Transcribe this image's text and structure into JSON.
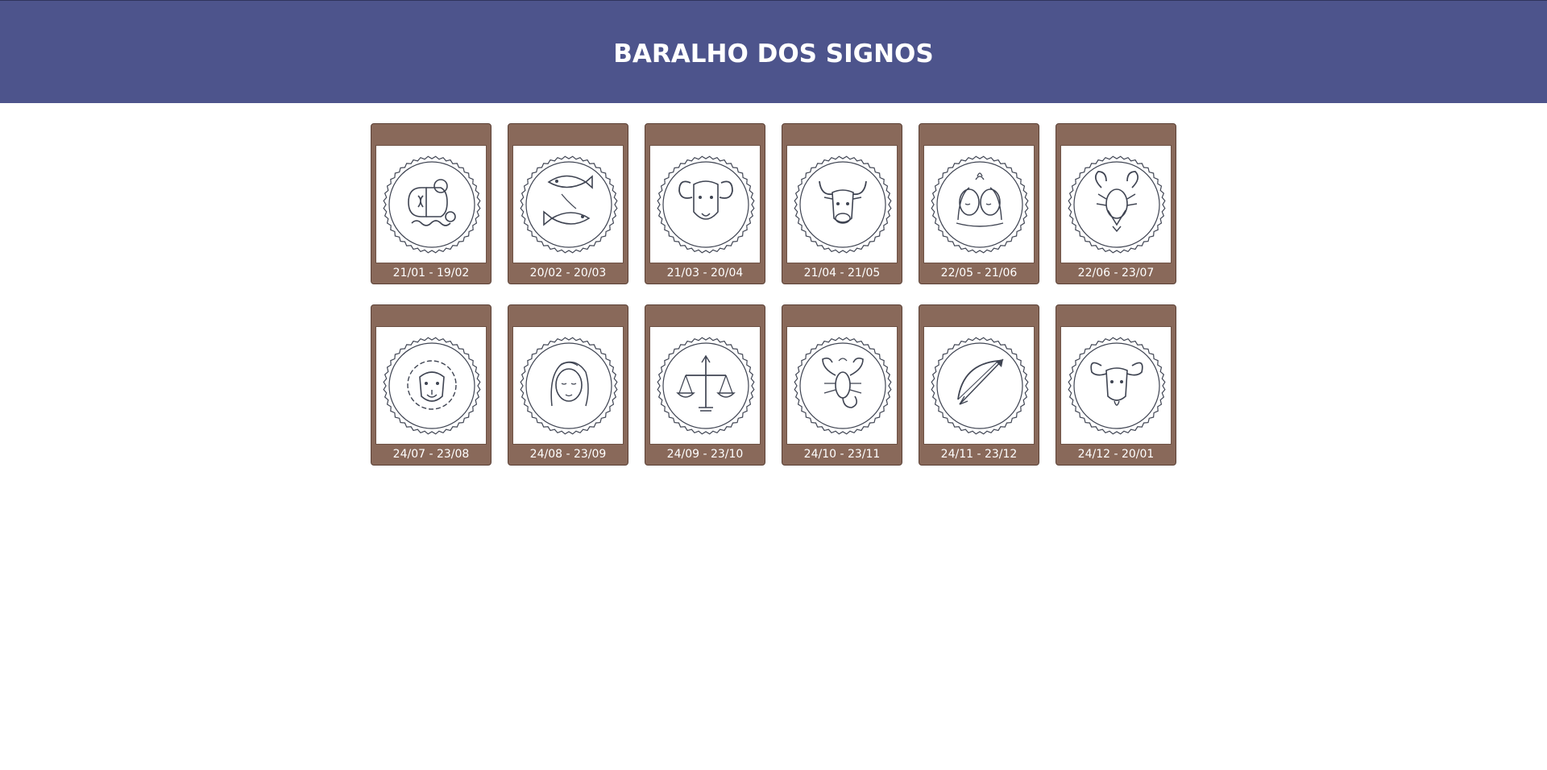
{
  "header": {
    "title": "BARALHO DOS SIGNOS"
  },
  "colors": {
    "header_bg": "#4d548c",
    "card_bg": "#89695a",
    "line": "#3f4452"
  },
  "cards": [
    {
      "sign": "aquarius",
      "icon": "aquarius-icon",
      "dates": "21/01 - 19/02"
    },
    {
      "sign": "pisces",
      "icon": "pisces-icon",
      "dates": "20/02 - 20/03"
    },
    {
      "sign": "aries",
      "icon": "aries-icon",
      "dates": "21/03 - 20/04"
    },
    {
      "sign": "taurus",
      "icon": "taurus-icon",
      "dates": "21/04 - 21/05"
    },
    {
      "sign": "gemini",
      "icon": "gemini-icon",
      "dates": "22/05 - 21/06"
    },
    {
      "sign": "cancer",
      "icon": "cancer-icon",
      "dates": "22/06 - 23/07"
    },
    {
      "sign": "leo",
      "icon": "leo-icon",
      "dates": "24/07 - 23/08"
    },
    {
      "sign": "virgo",
      "icon": "virgo-icon",
      "dates": "24/08 - 23/09"
    },
    {
      "sign": "libra",
      "icon": "libra-icon",
      "dates": "24/09 - 23/10"
    },
    {
      "sign": "scorpio",
      "icon": "scorpio-icon",
      "dates": "24/10 - 23/11"
    },
    {
      "sign": "sagittarius",
      "icon": "sagittarius-icon",
      "dates": "24/11 - 23/12"
    },
    {
      "sign": "capricorn",
      "icon": "capricorn-icon",
      "dates": "24/12 - 20/01"
    }
  ]
}
